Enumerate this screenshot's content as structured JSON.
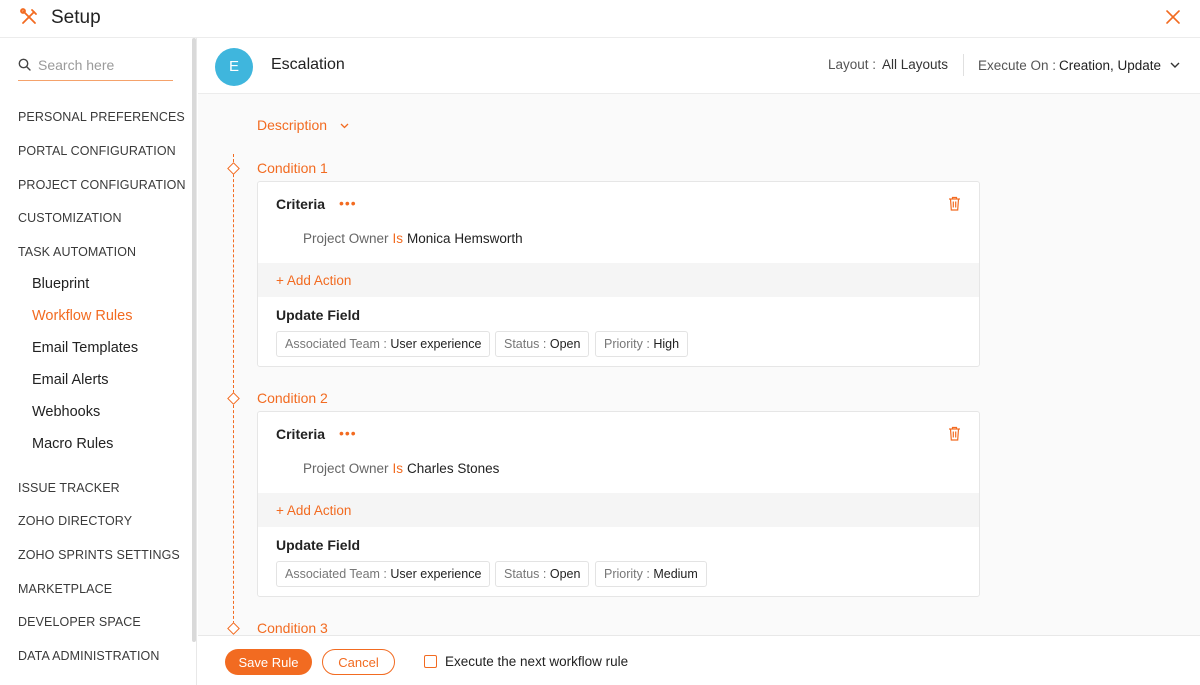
{
  "app": {
    "title": "Setup"
  },
  "sidebar": {
    "search_placeholder": "Search here",
    "sections": [
      "PERSONAL PREFERENCES",
      "PORTAL CONFIGURATION",
      "PROJECT CONFIGURATION",
      "CUSTOMIZATION",
      "TASK AUTOMATION"
    ],
    "task_automation_items": [
      "Blueprint",
      "Workflow Rules",
      "Email Templates",
      "Email Alerts",
      "Webhooks",
      "Macro Rules"
    ],
    "active_item": "Workflow Rules",
    "lower_sections": [
      "ISSUE TRACKER",
      "ZOHO DIRECTORY",
      "ZOHO SPRINTS SETTINGS",
      "MARKETPLACE",
      "DEVELOPER SPACE",
      "DATA ADMINISTRATION"
    ]
  },
  "rule": {
    "avatar_letter": "E",
    "name": "Escalation",
    "layout_label": "Layout :",
    "layout_value": "All Layouts",
    "execute_label": "Execute On :",
    "execute_value": "Creation, Update",
    "description_label": "Description"
  },
  "conditions": [
    {
      "title": "Condition 1",
      "criteria_label": "Criteria",
      "criteria_field": "Project Owner",
      "criteria_operator": "Is",
      "criteria_value": "Monica Hemsworth",
      "add_action_label": "+ Add Action",
      "action_title": "Update Field",
      "updates": [
        {
          "key": "Associated Team :",
          "value": "User experience"
        },
        {
          "key": "Status :",
          "value": "Open"
        },
        {
          "key": "Priority :",
          "value": "High"
        }
      ]
    },
    {
      "title": "Condition 2",
      "criteria_label": "Criteria",
      "criteria_field": "Project Owner",
      "criteria_operator": "Is",
      "criteria_value": "Charles Stones",
      "add_action_label": "+ Add Action",
      "action_title": "Update Field",
      "updates": [
        {
          "key": "Associated Team :",
          "value": "User experience"
        },
        {
          "key": "Status :",
          "value": "Open"
        },
        {
          "key": "Priority :",
          "value": "Medium"
        }
      ]
    },
    {
      "title": "Condition 3"
    }
  ],
  "footer": {
    "save_label": "Save Rule",
    "cancel_label": "Cancel",
    "execute_next_label": "Execute the next workflow rule",
    "execute_next_checked": false
  },
  "colors": {
    "accent": "#f26b21",
    "avatar": "#3fb6dd"
  }
}
